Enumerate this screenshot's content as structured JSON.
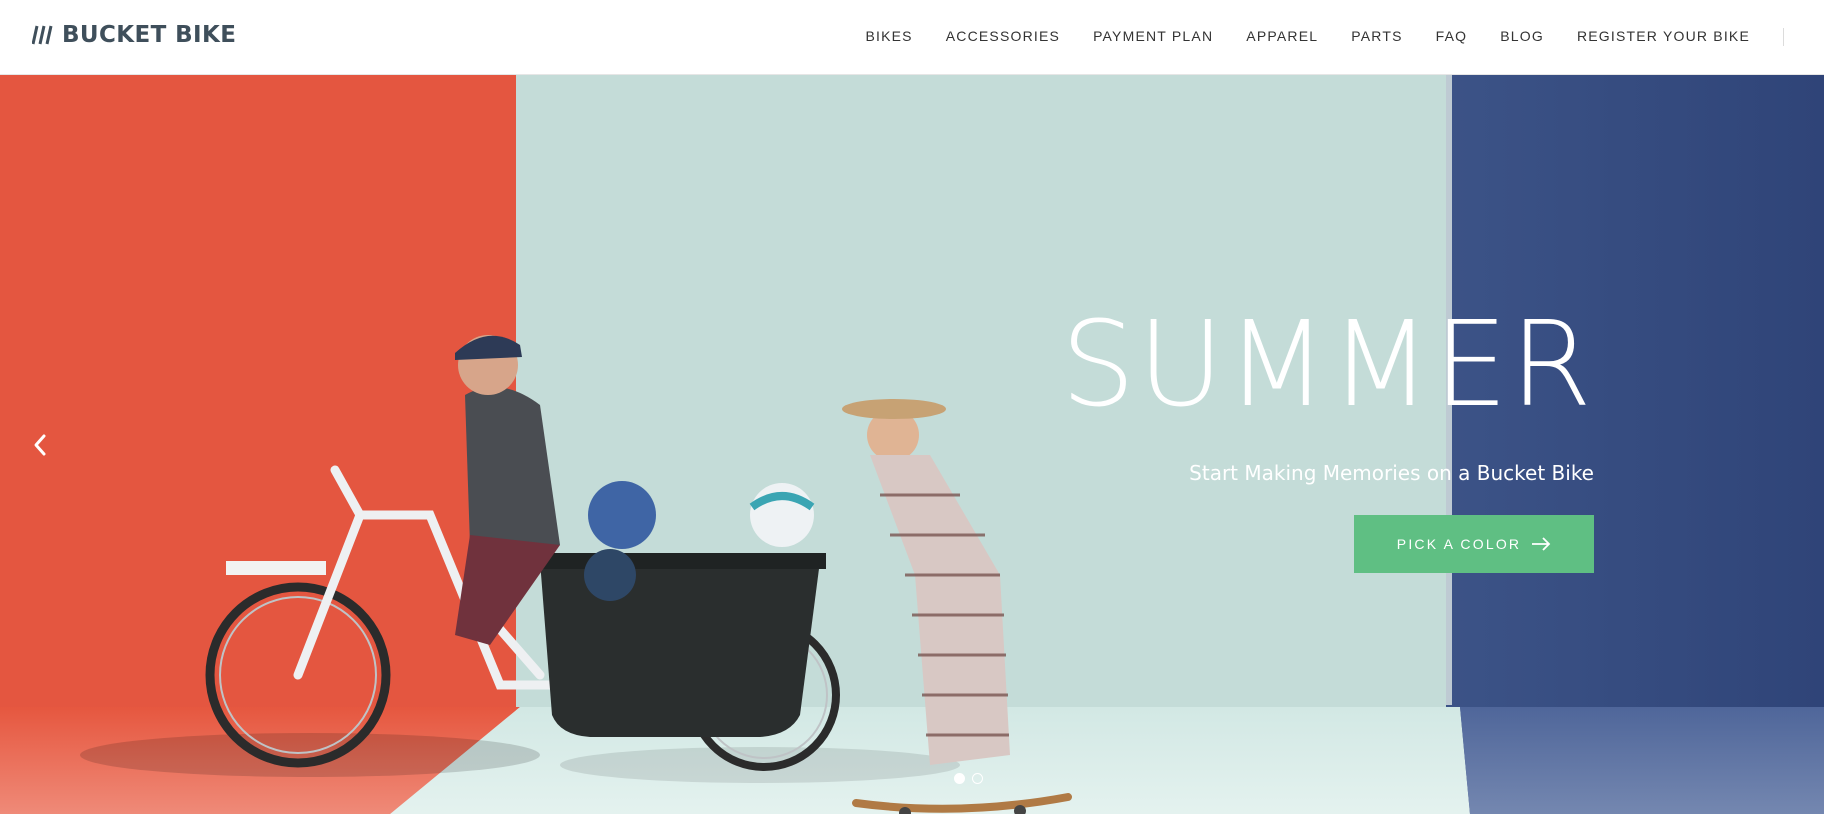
{
  "brand": {
    "logo_text": "BUCKET BIKE",
    "logo_icon": "triple-slash-icon",
    "color": "#3f4f5b"
  },
  "nav": {
    "items": [
      {
        "label": "BIKES"
      },
      {
        "label": "ACCESSORIES"
      },
      {
        "label": "PAYMENT PLAN"
      },
      {
        "label": "APPAREL"
      },
      {
        "label": "PARTS"
      },
      {
        "label": "FAQ"
      },
      {
        "label": "BLOG"
      },
      {
        "label": "REGISTER YOUR BIKE"
      }
    ]
  },
  "hero": {
    "title": "SUMMER",
    "subtitle": "Start Making Memories on a Bucket Bike",
    "cta_label": "PICK A COLOR",
    "cta_icon": "arrow-right-icon",
    "prev_icon": "chevron-left-icon",
    "slides_total": 2,
    "active_slide": 1,
    "colors": {
      "left_wall": "#e45640",
      "center_wall": "#c4dcd8",
      "right_wall": "#3b5388",
      "cta": "#5fbf83"
    }
  }
}
